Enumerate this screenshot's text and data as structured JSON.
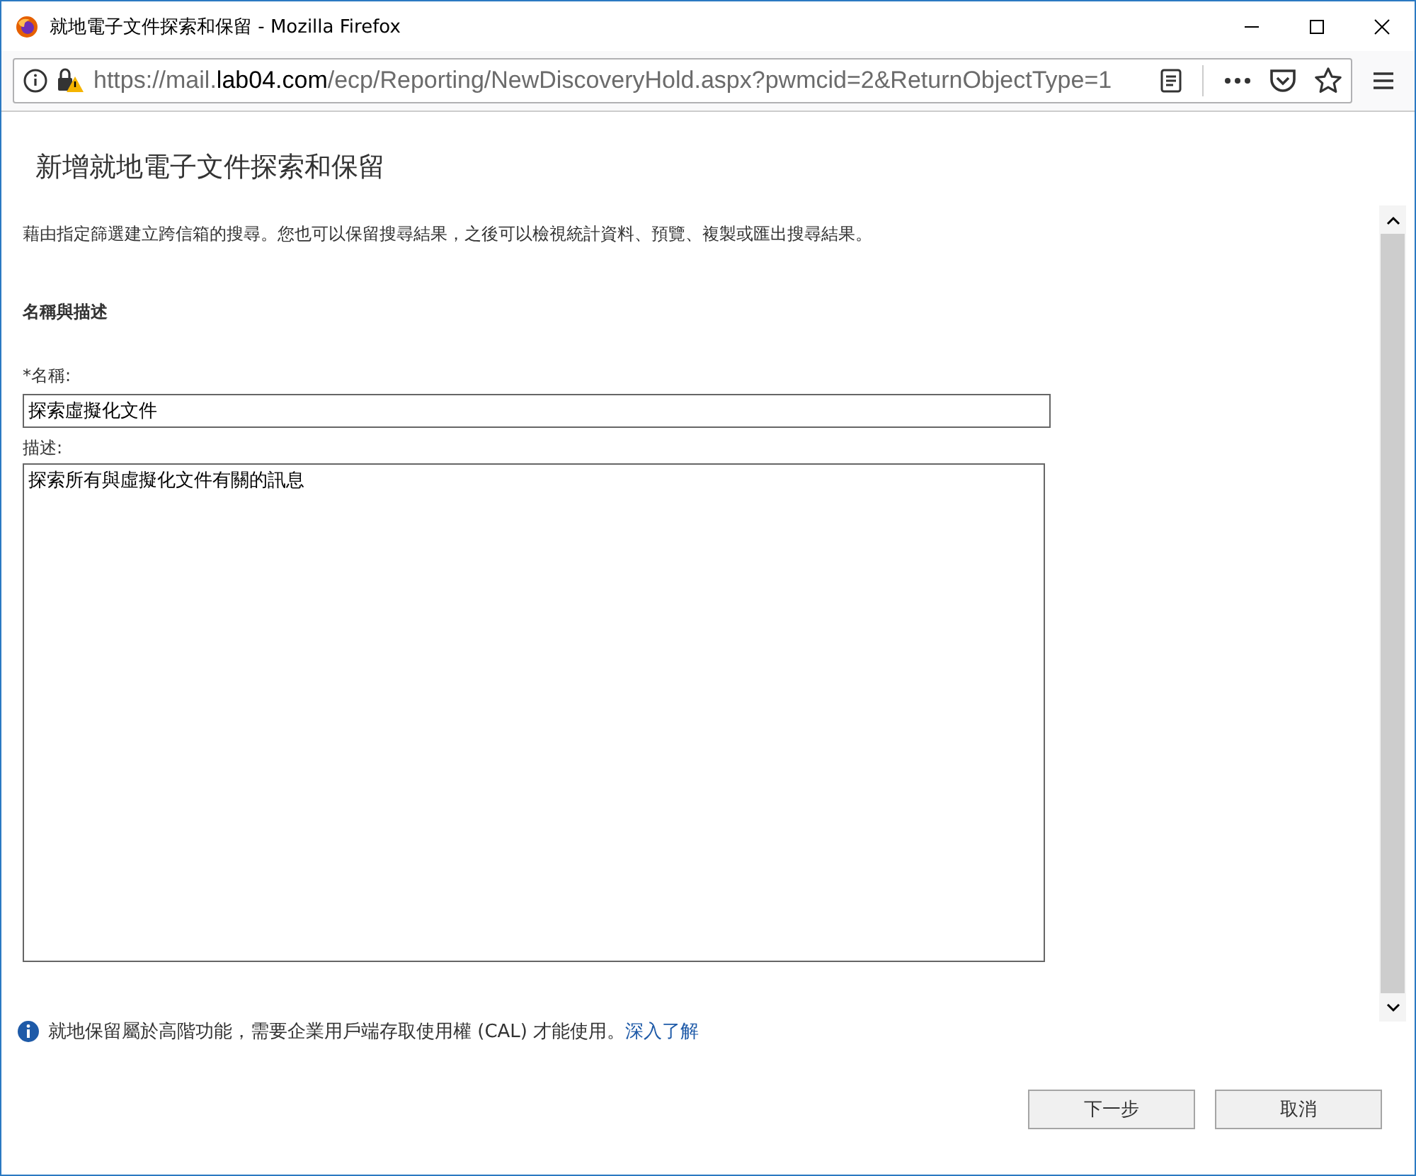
{
  "window": {
    "title": "就地電子文件探索和保留 - Mozilla Firefox"
  },
  "address_bar": {
    "url": "https://mail.**lab04.com**/ecp/Reporting/NewDiscoveryHold.aspx?pwmcid=2&ReturnObjectType=1"
  },
  "page": {
    "title": "新增就地電子文件探索和保留",
    "intro": "藉由指定篩選建立跨信箱的搜尋。您也可以保留搜尋結果，之後可以檢視統計資料、預覽、複製或匯出搜尋結果。",
    "section": "名稱與描述",
    "name_label": "*名稱:",
    "name_value": "探索虛擬化文件",
    "description_label": "描述:",
    "description_value": "探索所有與虛擬化文件有關的訊息",
    "notice": "就地保留屬於高階功能，需要企業用戶端存取使用權 (CAL) 才能使用。",
    "notice_link": "深入了解",
    "buttons": [
      "下一步",
      "取消"
    ]
  }
}
